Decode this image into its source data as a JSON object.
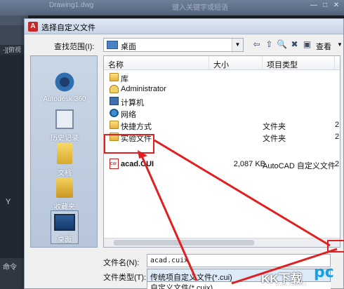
{
  "dialog": {
    "title": "选择自定义文件",
    "look_in_label": "查找范围(I):",
    "look_in_value": "桌面",
    "view_label": "查看",
    "file_name_label": "文件名(N):",
    "file_name_value": "acad.cuix",
    "file_type_label": "文件类型(T):",
    "file_type_value": "传统项自定义文件(*.cui)",
    "file_type_option": "自定义文件(*.cuix)",
    "file_type_option2": "*.*"
  },
  "places": [
    {
      "label": "Autodesk 360",
      "icon": "cloud-icon"
    },
    {
      "label": "历史记录",
      "icon": "history-icon"
    },
    {
      "label": "文档",
      "icon": "documents-icon"
    },
    {
      "label": "收藏夹",
      "icon": "favorites-icon"
    },
    {
      "label": "桌面",
      "icon": "desktop-icon"
    }
  ],
  "columns": {
    "name": "名称",
    "size": "大小",
    "type": "项目类型"
  },
  "files": [
    {
      "name": "库",
      "size": "",
      "type": "",
      "date": "",
      "icon": "folder"
    },
    {
      "name": "Administrator",
      "size": "",
      "type": "",
      "date": "",
      "icon": "user"
    },
    {
      "name": "计算机",
      "size": "",
      "type": "",
      "date": "",
      "icon": "computer"
    },
    {
      "name": "网络",
      "size": "",
      "type": "",
      "date": "",
      "icon": "network"
    },
    {
      "name": "快捷方式",
      "size": "",
      "type": "文件夹",
      "date": "2",
      "icon": "folder"
    },
    {
      "name": "实验文件",
      "size": "",
      "type": "文件夹",
      "date": "2",
      "icon": "folder"
    },
    {
      "name": "acad.CUI",
      "size": "2,087 KB",
      "type": "AutoCAD 自定义文件",
      "date": "2",
      "icon": "cui"
    }
  ],
  "background": {
    "app_title_left": "Drawing1.dwg",
    "app_title_right": "键入关键字或短语",
    "tab_label": "-][俯视",
    "cmd_label": "命令",
    "axis_label": "Y"
  },
  "watermark": {
    "text": "KK下载",
    "logo": "pc",
    "url": "www.kkx.net"
  },
  "colors": {
    "annotation": "#e02020",
    "accent": "#4a7fc4"
  }
}
